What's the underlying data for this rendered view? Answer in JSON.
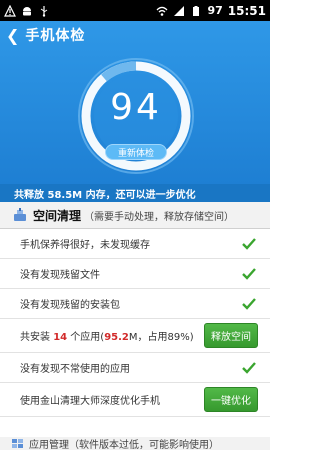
{
  "status_bar": {
    "battery_percent": "97",
    "time": "15:51"
  },
  "header": {
    "title": "手机体检"
  },
  "score": {
    "value": "94",
    "recheck_label": "重新体检"
  },
  "summary": {
    "text": "共释放 58.5M 内存，还可以进一步优化"
  },
  "section": {
    "title": "空间清理",
    "note": "（需要手动处理，释放存储空间）"
  },
  "rows": {
    "r0": {
      "text": "手机保养得很好，未发现缓存"
    },
    "r1": {
      "text": "没有发现残留文件"
    },
    "r2": {
      "text": "没有发现残留的安装包"
    },
    "r3": {
      "prefix": "共安装",
      "apps_count": "14",
      "middle": "个应用(",
      "size": "95.2",
      "suffix": "M，占用89%)",
      "button": "释放空间"
    },
    "r4": {
      "text": "没有发现不常使用的应用"
    },
    "r5": {
      "text": "使用金山清理大师深度优化手机",
      "button": "一键优化"
    }
  },
  "bottom_section": {
    "text": "应用管理（软件版本过低，可能影响使用）"
  },
  "colors": {
    "hero_blue": "#2f98e7",
    "summary_blue": "#1976c4",
    "check_green": "#3aa52f",
    "button_green": "#46ad3c",
    "highlight_red": "#d22a2a"
  }
}
